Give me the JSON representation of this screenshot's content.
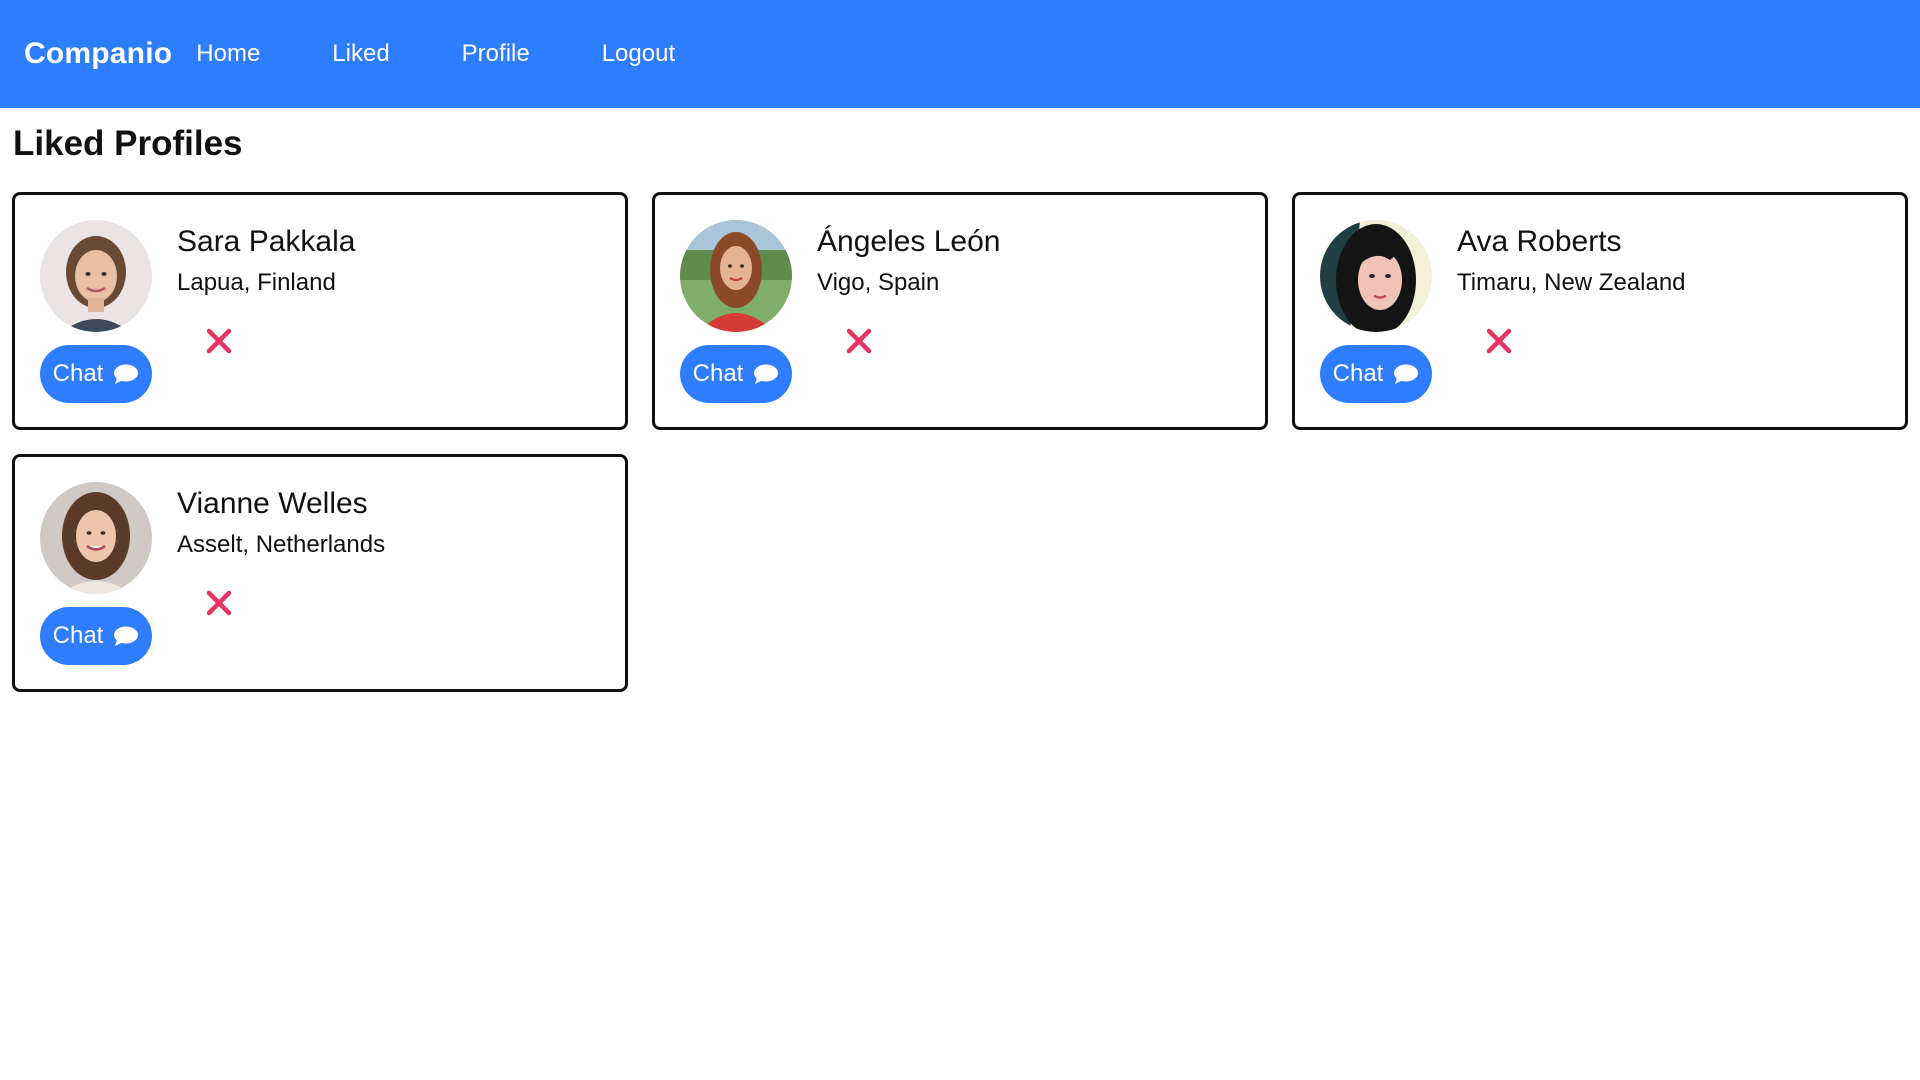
{
  "app": {
    "brand": "Companio",
    "nav": [
      {
        "label": "Home"
      },
      {
        "label": "Liked"
      },
      {
        "label": "Profile"
      },
      {
        "label": "Logout"
      }
    ]
  },
  "page": {
    "title": "Liked Profiles"
  },
  "profiles": [
    {
      "name": "Sara Pakkala",
      "location": "Lapua, Finland",
      "chat_label": "Chat",
      "chat_icon": "chat-bubble-icon",
      "remove_icon": "close-icon"
    },
    {
      "name": "Ángeles León",
      "location": "Vigo, Spain",
      "chat_label": "Chat",
      "chat_icon": "chat-bubble-icon",
      "remove_icon": "close-icon"
    },
    {
      "name": "Ava Roberts",
      "location": "Timaru, New Zealand",
      "chat_label": "Chat",
      "chat_icon": "chat-bubble-icon",
      "remove_icon": "close-icon"
    },
    {
      "name": "Vianne Welles",
      "location": "Asselt, Netherlands",
      "chat_label": "Chat",
      "chat_icon": "chat-bubble-icon",
      "remove_icon": "close-icon"
    }
  ],
  "colors": {
    "accent": "#2e7dff",
    "remove": "#e8325f",
    "card_border": "#111111"
  }
}
